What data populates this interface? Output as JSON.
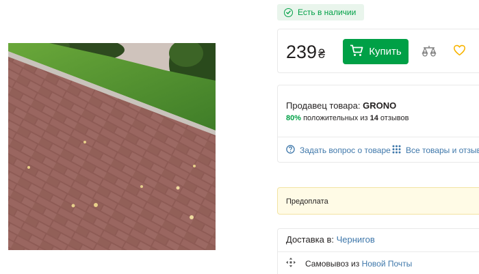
{
  "product": {
    "image_alt": "Тротуарная плитка",
    "stock_status": "Есть в наличии",
    "price": "239",
    "currency": "₴",
    "buy_label": "Купить"
  },
  "seller": {
    "label": "Продавец товара:",
    "name": "GRONO",
    "positive_percent": "80%",
    "positive_text": "положительных из",
    "reviews_count": "14",
    "reviews_word": "отзывов",
    "ask_label": "Задать вопрос о товаре",
    "all_products_label": "Все товары и отзывы"
  },
  "payment": {
    "prepayment_label": "Предоплата"
  },
  "delivery": {
    "label": "Доставка в:",
    "city": "Чернигов",
    "pickup_label": "Самовывоз из",
    "pickup_carrier": "Новой Почты"
  },
  "colors": {
    "accent_green": "#00a046",
    "link_blue": "#3e77aa",
    "heart_yellow": "#f8b400"
  }
}
